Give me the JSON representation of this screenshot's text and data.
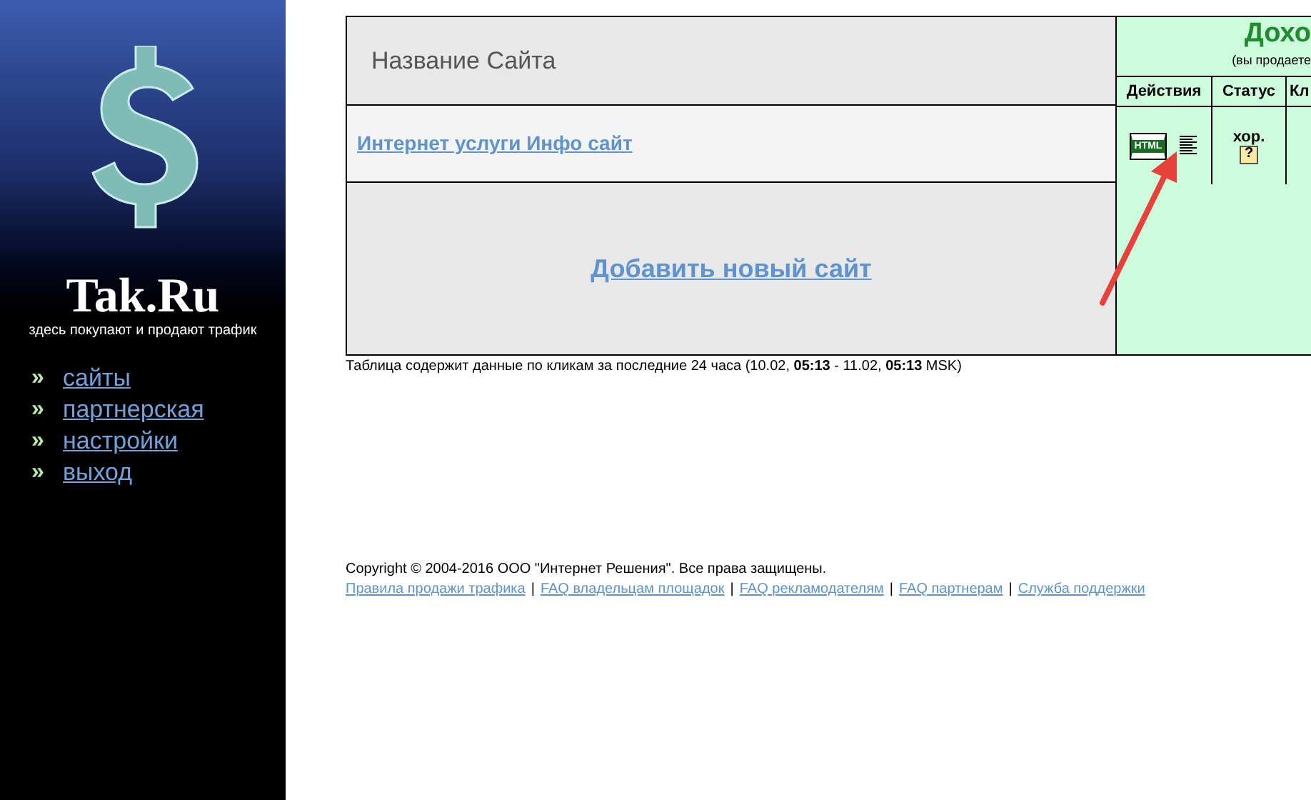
{
  "sidebar": {
    "logo": "Tak.Ru",
    "tagline": "здесь покупают и продают трафик",
    "bullet": "»",
    "menu": [
      {
        "label": "сайты"
      },
      {
        "label": "партнерская"
      },
      {
        "label": "настройки"
      },
      {
        "label": "выход"
      }
    ]
  },
  "table": {
    "name_header": "Название Сайта",
    "income_title": "Дохо",
    "income_subtitle": "(вы продаете",
    "columns": [
      "Действия",
      "Статус",
      "Кл"
    ],
    "rows": [
      {
        "site": "Интернет услуги Инфо сайт",
        "action_label": "HTML",
        "status": "хор.",
        "status_icon": "?"
      }
    ],
    "add_site": "Добавить новый сайт"
  },
  "note": "Таблица содержит данные по кликам за последние 24 часа (10.02, **05:13** - 11.02, **05:13** MSK)",
  "footer": {
    "copyright": "Copyright © 2004-2016 ООО \"Интернет Решения\". Все права защищены.",
    "separator": "|",
    "links": [
      "Правила продажи трафика",
      "FAQ владельцам площадок",
      "FAQ рекламодателям",
      "FAQ партнерам",
      "Служба поддержки"
    ]
  }
}
